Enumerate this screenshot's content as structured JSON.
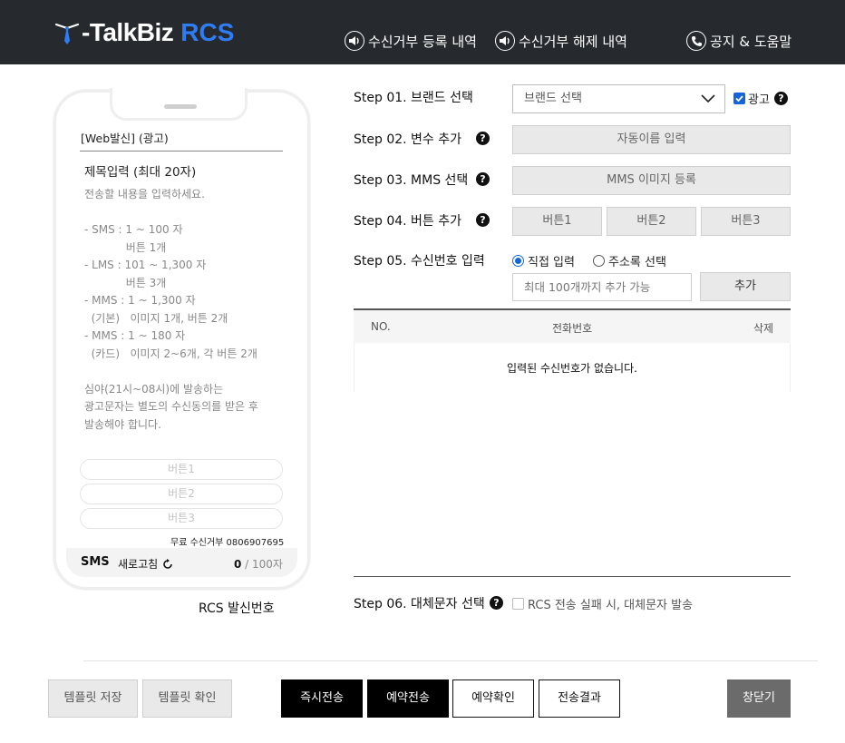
{
  "header": {
    "logo_text": "-TalkBiz",
    "logo_rcs": "RCS",
    "nav": [
      {
        "label": "수신거부 등록 내역",
        "icon": "speaker-icon"
      },
      {
        "label": "수신거부 해제 내역",
        "icon": "speaker-icon"
      },
      {
        "label": "공지 & 도움말",
        "icon": "phone-icon"
      }
    ]
  },
  "preview": {
    "sender": "[Web발신] (광고)",
    "title": "제목입력 (최대 20자)",
    "body": "전송할 내용을 입력하세요.\n\n- SMS : 1 ~ 100 자\n            버튼 1개\n- LMS : 101 ~ 1,300 자\n            버튼 3개\n- MMS : 1 ~ 1,300 자\n  (기본)   이미지 1개, 버튼 2개\n- MMS : 1 ~ 180 자\n  (카드)   이미지 2~6개, 각 버튼 2개\n\n심야(21시~08시)에 발송하는\n광고문자는 별도의 수신동의를 받은 후\n발송해야 합니다.",
    "buttons": [
      "버튼1",
      "버튼2",
      "버튼3"
    ],
    "reject_text": "무료 수신거부 0806907695",
    "type": "SMS",
    "refresh_label": "새로고침",
    "count": "0",
    "count_max": " / 100자",
    "caption": "RCS 발신번호"
  },
  "steps": {
    "s1": {
      "label": "Step 01. 브랜드 선택",
      "select": "브랜드 선택",
      "ad_label": "광고",
      "ad_checked": true
    },
    "s2": {
      "label": "Step 02. 변수 추가",
      "button": "자동이름 입력"
    },
    "s3": {
      "label": "Step 03. MMS 선택",
      "button": "MMS 이미지 등록"
    },
    "s4": {
      "label": "Step 04. 버튼 추가",
      "buttons": [
        "버튼1",
        "버튼2",
        "버튼3"
      ]
    },
    "s5": {
      "label": "Step 05. 수신번호 입력",
      "radio_direct": "직접 입력",
      "radio_address": "주소록 선택",
      "selected": "direct",
      "placeholder": "최대 100개까지 추가 가능",
      "add_button": "추가",
      "table": {
        "col_no": "NO.",
        "col_phone": "전화번호",
        "col_delete": "삭제",
        "empty": "입력된 수신번호가 없습니다."
      }
    },
    "s6": {
      "label": "Step 06. 대체문자 선택",
      "checkbox": "RCS 전송 실패 시, 대체문자 발송",
      "checked": false
    }
  },
  "footer": {
    "template_save": "템플릿 저장",
    "template_check": "템플릿 확인",
    "send_now": "즉시전송",
    "send_reserve": "예약전송",
    "reserve_check": "예약확인",
    "send_result": "전송결과",
    "close": "창닫기"
  },
  "colors": {
    "header_bg": "#26292e",
    "accent": "#2f7df6",
    "radio": "#1565d8"
  }
}
